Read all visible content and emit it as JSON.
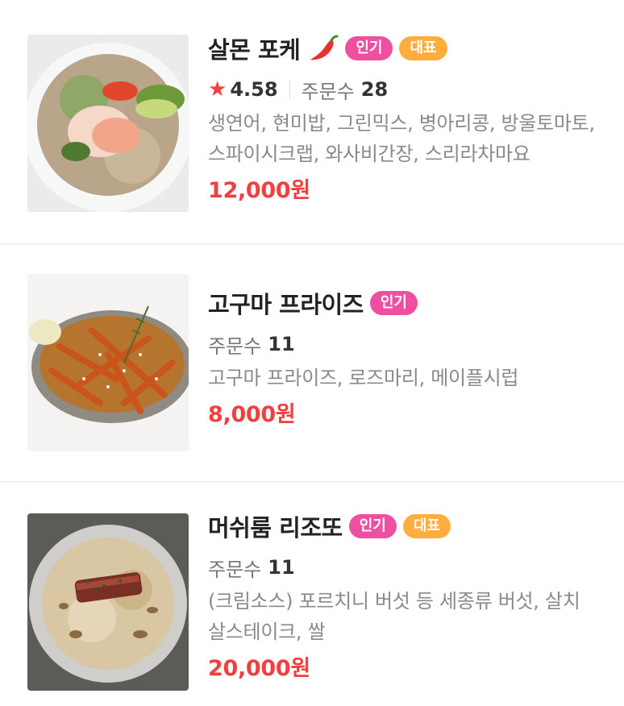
{
  "menu": {
    "items": [
      {
        "name": "살몬 포케",
        "spicy": true,
        "badges": [
          "인기",
          "대표"
        ],
        "rating": "4.58",
        "order_label": "주문수",
        "order_count": "28",
        "description": "생연어, 현미밥, 그린믹스, 병아리콩, 방울토마토, 스파이시크랩, 와사비간장, 스리라차마요",
        "price": "12,000원"
      },
      {
        "name": "고구마 프라이즈",
        "spicy": false,
        "badges": [
          "인기"
        ],
        "order_label": "주문수",
        "order_count": "11",
        "description": "고구마 프라이즈, 로즈마리, 메이플시럽",
        "price": "8,000원"
      },
      {
        "name": "머쉬룸 리조또",
        "spicy": false,
        "badges": [
          "인기",
          "대표"
        ],
        "order_label": "주문수",
        "order_count": "11",
        "description": "(크림소스) 포르치니 버섯 등 세종류 버섯, 살치살스테이크, 쌀",
        "price": "20,000원"
      }
    ]
  },
  "colors": {
    "price": "#ef4040",
    "badge_popular": "#ee4fa1",
    "badge_signature": "#ffae3d",
    "star": "#f24141"
  },
  "icons": {
    "star": "star-icon",
    "spicy": "chili-pepper-icon"
  }
}
